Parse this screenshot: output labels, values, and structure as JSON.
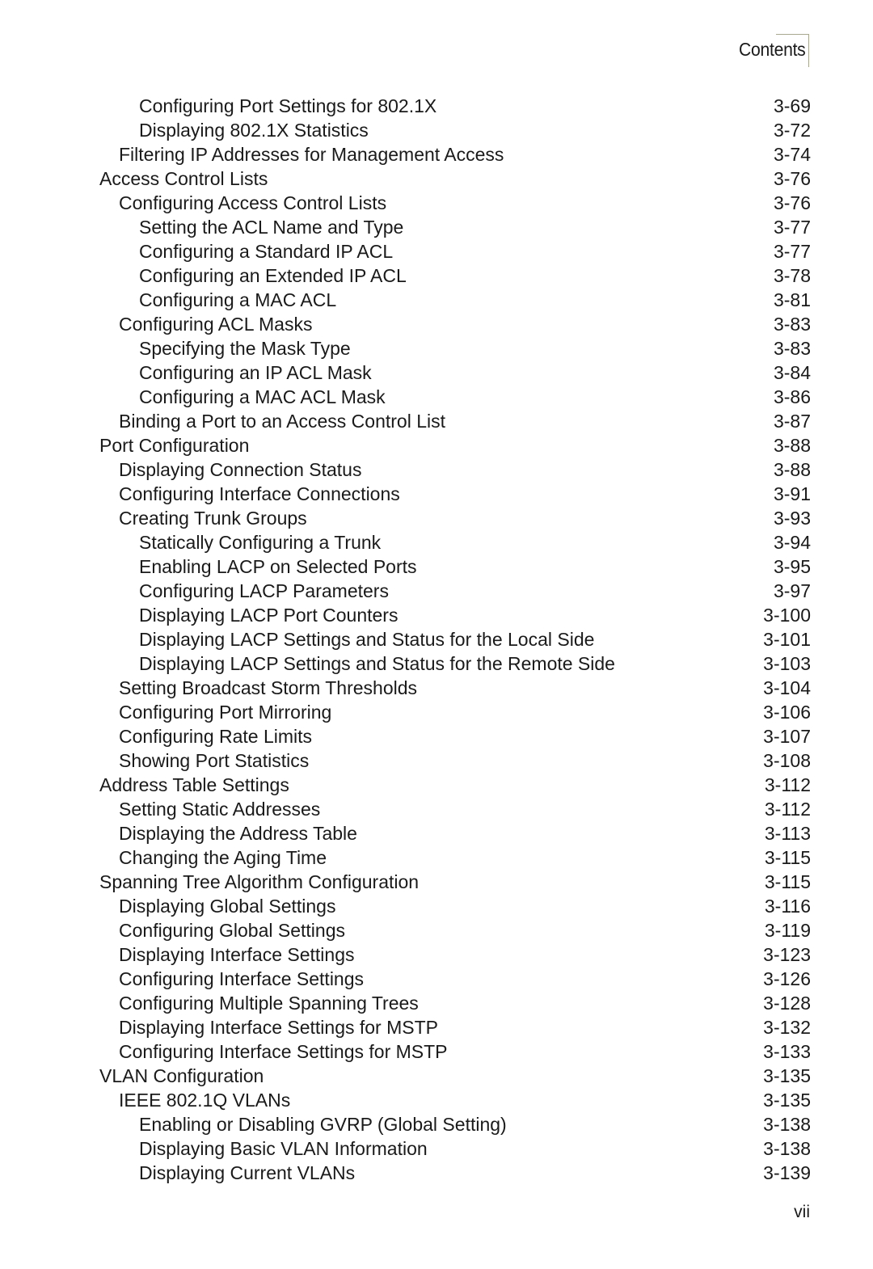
{
  "header": {
    "title": "Contents"
  },
  "toc": [
    {
      "level": 2,
      "title": "Configuring Port Settings for 802.1X",
      "page": "3-69"
    },
    {
      "level": 2,
      "title": "Displaying 802.1X Statistics",
      "page": "3-72"
    },
    {
      "level": 1,
      "title": "Filtering IP Addresses for Management Access",
      "page": "3-74"
    },
    {
      "level": 0,
      "title": "Access Control Lists",
      "page": "3-76"
    },
    {
      "level": 1,
      "title": "Configuring Access Control Lists",
      "page": "3-76"
    },
    {
      "level": 2,
      "title": "Setting the ACL Name and Type",
      "page": "3-77"
    },
    {
      "level": 2,
      "title": "Configuring a Standard IP ACL",
      "page": "3-77"
    },
    {
      "level": 2,
      "title": "Configuring an Extended IP ACL",
      "page": "3-78"
    },
    {
      "level": 2,
      "title": "Configuring a MAC ACL",
      "page": "3-81"
    },
    {
      "level": 1,
      "title": "Configuring ACL Masks",
      "page": "3-83"
    },
    {
      "level": 2,
      "title": "Specifying the Mask Type",
      "page": "3-83"
    },
    {
      "level": 2,
      "title": "Configuring an IP ACL Mask",
      "page": "3-84"
    },
    {
      "level": 2,
      "title": "Configuring a MAC ACL Mask",
      "page": "3-86"
    },
    {
      "level": 1,
      "title": "Binding a Port to an Access Control List",
      "page": "3-87"
    },
    {
      "level": 0,
      "title": "Port Configuration",
      "page": "3-88"
    },
    {
      "level": 1,
      "title": "Displaying Connection Status",
      "page": "3-88"
    },
    {
      "level": 1,
      "title": "Configuring Interface Connections",
      "page": "3-91"
    },
    {
      "level": 1,
      "title": "Creating Trunk Groups",
      "page": "3-93"
    },
    {
      "level": 2,
      "title": "Statically Configuring a Trunk",
      "page": "3-94"
    },
    {
      "level": 2,
      "title": "Enabling LACP on Selected Ports",
      "page": "3-95"
    },
    {
      "level": 2,
      "title": "Configuring LACP Parameters",
      "page": "3-97"
    },
    {
      "level": 2,
      "title": "Displaying LACP Port Counters",
      "page": "3-100"
    },
    {
      "level": 2,
      "title": "Displaying LACP Settings and Status for the Local Side",
      "page": "3-101"
    },
    {
      "level": 2,
      "title": "Displaying LACP Settings and Status for the Remote Side",
      "page": "3-103"
    },
    {
      "level": 1,
      "title": "Setting Broadcast Storm Thresholds",
      "page": "3-104"
    },
    {
      "level": 1,
      "title": "Configuring Port Mirroring",
      "page": "3-106"
    },
    {
      "level": 1,
      "title": "Configuring Rate Limits",
      "page": "3-107"
    },
    {
      "level": 1,
      "title": "Showing Port Statistics",
      "page": "3-108"
    },
    {
      "level": 0,
      "title": "Address Table Settings",
      "page": "3-112"
    },
    {
      "level": 1,
      "title": "Setting Static Addresses",
      "page": "3-112"
    },
    {
      "level": 1,
      "title": "Displaying the Address Table",
      "page": "3-113"
    },
    {
      "level": 1,
      "title": "Changing the Aging Time",
      "page": "3-115"
    },
    {
      "level": 0,
      "title": "Spanning Tree Algorithm Configuration",
      "page": "3-115"
    },
    {
      "level": 1,
      "title": "Displaying Global Settings",
      "page": "3-116"
    },
    {
      "level": 1,
      "title": "Configuring Global Settings",
      "page": "3-119"
    },
    {
      "level": 1,
      "title": "Displaying Interface Settings",
      "page": "3-123"
    },
    {
      "level": 1,
      "title": "Configuring Interface Settings",
      "page": "3-126"
    },
    {
      "level": 1,
      "title": "Configuring Multiple Spanning Trees",
      "page": "3-128"
    },
    {
      "level": 1,
      "title": "Displaying Interface Settings for MSTP",
      "page": "3-132"
    },
    {
      "level": 1,
      "title": "Configuring Interface Settings for MSTP",
      "page": "3-133"
    },
    {
      "level": 0,
      "title": "VLAN Configuration",
      "page": "3-135"
    },
    {
      "level": 1,
      "title": "IEEE 802.1Q VLANs",
      "page": "3-135"
    },
    {
      "level": 2,
      "title": "Enabling or Disabling GVRP (Global Setting)",
      "page": "3-138"
    },
    {
      "level": 2,
      "title": "Displaying Basic VLAN Information",
      "page": "3-138"
    },
    {
      "level": 2,
      "title": "Displaying Current VLANs",
      "page": "3-139"
    }
  ],
  "footer": {
    "page_number": "vii"
  }
}
